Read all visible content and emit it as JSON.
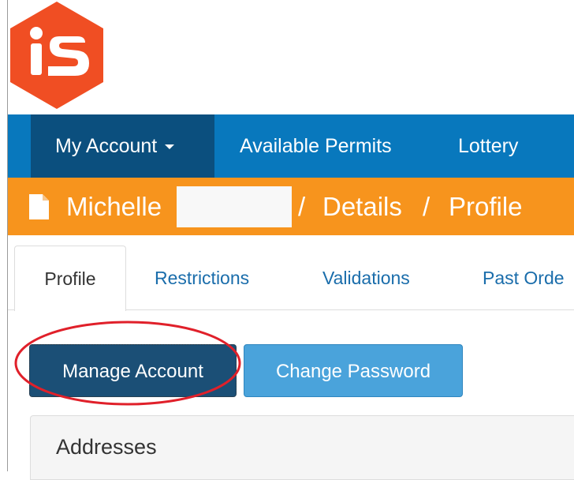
{
  "brand": {
    "logo_text": "iS",
    "logo_color": "#f04e23"
  },
  "navbar": {
    "bg_color": "#0878bd",
    "items": [
      {
        "label": "My Account",
        "has_dropdown": true,
        "active": true
      },
      {
        "label": "Available Permits"
      },
      {
        "label": "Lottery"
      }
    ]
  },
  "breadcrumb": {
    "bg_color": "#f7941d",
    "name": "Michelle",
    "separator": "/",
    "details": "Details",
    "profile": "Profile"
  },
  "tabs": [
    {
      "label": "Profile",
      "active": true
    },
    {
      "label": "Restrictions"
    },
    {
      "label": "Validations"
    },
    {
      "label": "Past Orde"
    }
  ],
  "actions": {
    "manage_label": "Manage Account",
    "change_password_label": "Change Password"
  },
  "addresses_panel": {
    "title": "Addresses"
  },
  "annotation": {
    "color": "#e0202a"
  }
}
